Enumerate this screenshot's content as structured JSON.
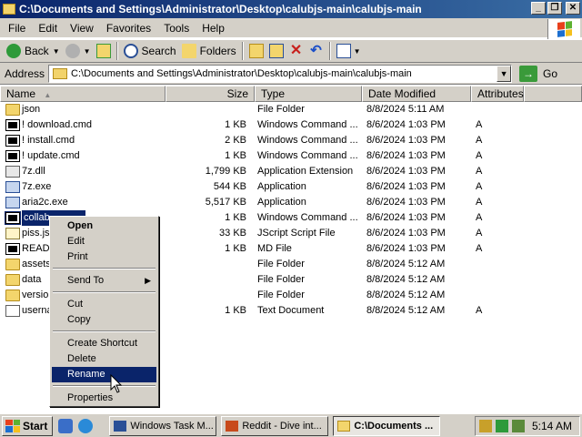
{
  "window": {
    "title": "C:\\Documents and Settings\\Administrator\\Desktop\\calubjs-main\\calubjs-main",
    "buttons": {
      "minimize": "_",
      "maximize": "❐",
      "close": "✕"
    }
  },
  "menu": [
    {
      "label": "File"
    },
    {
      "label": "Edit"
    },
    {
      "label": "View"
    },
    {
      "label": "Favorites"
    },
    {
      "label": "Tools"
    },
    {
      "label": "Help"
    }
  ],
  "toolbar": {
    "back": "Back",
    "search": "Search",
    "folders": "Folders"
  },
  "address": {
    "label": "Address",
    "value": "C:\\Documents and Settings\\Administrator\\Desktop\\calubjs-main\\calubjs-main",
    "go": "Go"
  },
  "columns": {
    "name": "Name",
    "size": "Size",
    "type": "Type",
    "date": "Date Modified",
    "attributes": "Attributes"
  },
  "files": [
    {
      "name": "json",
      "size": "",
      "type": "File Folder",
      "date": "8/8/2024 5:11 AM",
      "attr": "",
      "icon": "folder-icon"
    },
    {
      "name": "! download.cmd",
      "size": "1 KB",
      "type": "Windows Command ...",
      "date": "8/6/2024 1:03 PM",
      "attr": "A",
      "icon": "cmd-icon"
    },
    {
      "name": "! install.cmd",
      "size": "2 KB",
      "type": "Windows Command ...",
      "date": "8/6/2024 1:03 PM",
      "attr": "A",
      "icon": "cmd-icon"
    },
    {
      "name": "! update.cmd",
      "size": "1 KB",
      "type": "Windows Command ...",
      "date": "8/6/2024 1:03 PM",
      "attr": "A",
      "icon": "cmd-icon"
    },
    {
      "name": "7z.dll",
      "size": "1,799 KB",
      "type": "Application Extension",
      "date": "8/6/2024 1:03 PM",
      "attr": "A",
      "icon": "dll-icon"
    },
    {
      "name": "7z.exe",
      "size": "544 KB",
      "type": "Application",
      "date": "8/6/2024 1:03 PM",
      "attr": "A",
      "icon": "exe-icon"
    },
    {
      "name": "aria2c.exe",
      "size": "5,517 KB",
      "type": "Application",
      "date": "8/6/2024 1:03 PM",
      "attr": "A",
      "icon": "exe-icon"
    },
    {
      "name": "collab",
      "size": "1 KB",
      "type": "Windows Command ...",
      "date": "8/6/2024 1:03 PM",
      "attr": "A",
      "icon": "cmd-icon"
    },
    {
      "name": "piss.js",
      "size": "33 KB",
      "type": "JScript Script File",
      "date": "8/6/2024 1:03 PM",
      "attr": "A",
      "icon": "js-icon"
    },
    {
      "name": "READM",
      "size": "1 KB",
      "type": "MD File",
      "date": "8/6/2024 1:03 PM",
      "attr": "A",
      "icon": "cmd-icon"
    },
    {
      "name": "assets",
      "size": "",
      "type": "File Folder",
      "date": "8/8/2024 5:12 AM",
      "attr": "",
      "icon": "folder-icon"
    },
    {
      "name": "data",
      "size": "",
      "type": "File Folder",
      "date": "8/8/2024 5:12 AM",
      "attr": "",
      "icon": "folder-icon"
    },
    {
      "name": "version",
      "size": "",
      "type": "File Folder",
      "date": "8/8/2024 5:12 AM",
      "attr": "",
      "icon": "folder-icon"
    },
    {
      "name": "userna",
      "size": "1 KB",
      "type": "Text Document",
      "date": "8/8/2024 5:12 AM",
      "attr": "A",
      "icon": "text-icon"
    }
  ],
  "context_menu": {
    "open": "Open",
    "edit": "Edit",
    "print": "Print",
    "send_to": "Send To",
    "cut": "Cut",
    "copy": "Copy",
    "create_shortcut": "Create Shortcut",
    "delete": "Delete",
    "rename": "Rename",
    "properties": "Properties"
  },
  "taskbar": {
    "start": "Start",
    "tasks": [
      {
        "label": "Windows Task M..."
      },
      {
        "label": "Reddit - Dive int..."
      },
      {
        "label": "C:\\Documents ..."
      }
    ],
    "clock": "5:14 AM"
  },
  "colors": {
    "titlebar": "#0a246a",
    "selection": "#0a246a",
    "face": "#d4d0c8"
  }
}
